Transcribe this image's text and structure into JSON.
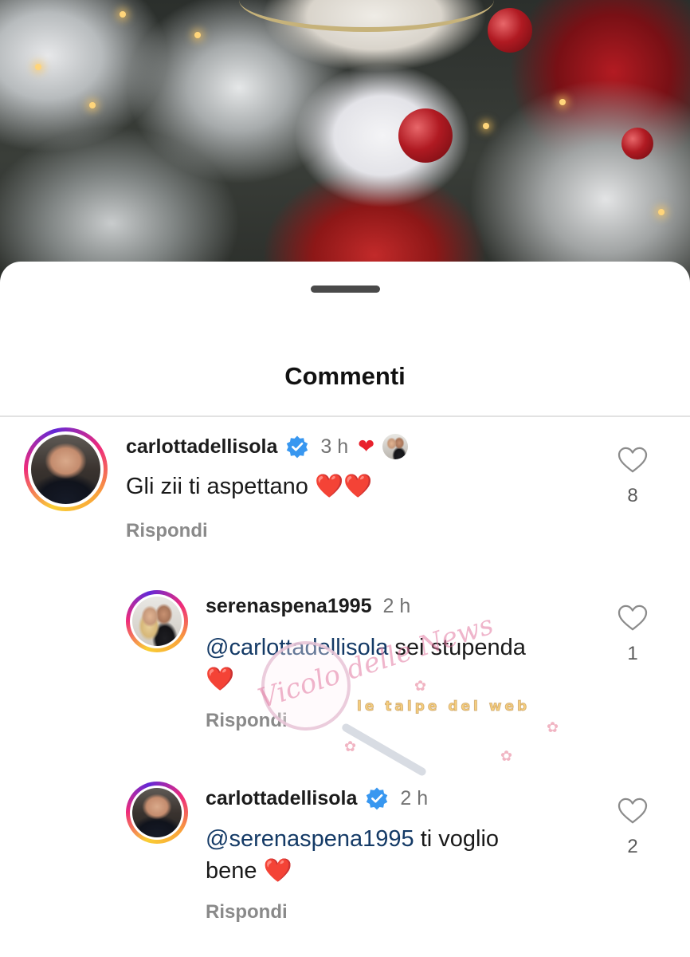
{
  "sheet": {
    "title": "Commenti"
  },
  "comments": [
    {
      "username": "carlottadellisola",
      "verified": true,
      "time": "3 h",
      "liked_by_author": true,
      "text": "Gli zii ti aspettano",
      "emoji": "❤️❤️",
      "reply_label": "Rispondi",
      "likes": "8"
    },
    {
      "username": "serenaspena1995",
      "verified": false,
      "time": "2 h",
      "mention": "@carlottadellisola",
      "text": " sei stupenda",
      "emoji": "❤️",
      "reply_label": "Rispondi",
      "likes": "1"
    },
    {
      "username": "carlottadellisola",
      "verified": true,
      "time": "2 h",
      "mention": "@serenaspena1995",
      "text": " ti voglio",
      "text_line2": "bene",
      "emoji": "❤️",
      "reply_label": "Rispondi",
      "likes": "2"
    }
  ],
  "watermark": {
    "script": "Vicolo delle News",
    "text": "le talpe del web"
  },
  "colors": {
    "mention": "#143a66",
    "verified": "#3897f0",
    "heart": "#e01b24",
    "secondary_text": "#8a8a8a"
  },
  "icons": {
    "like": "heart-outline-icon",
    "verified": "verified-badge-icon",
    "handle": "drag-handle-icon"
  }
}
